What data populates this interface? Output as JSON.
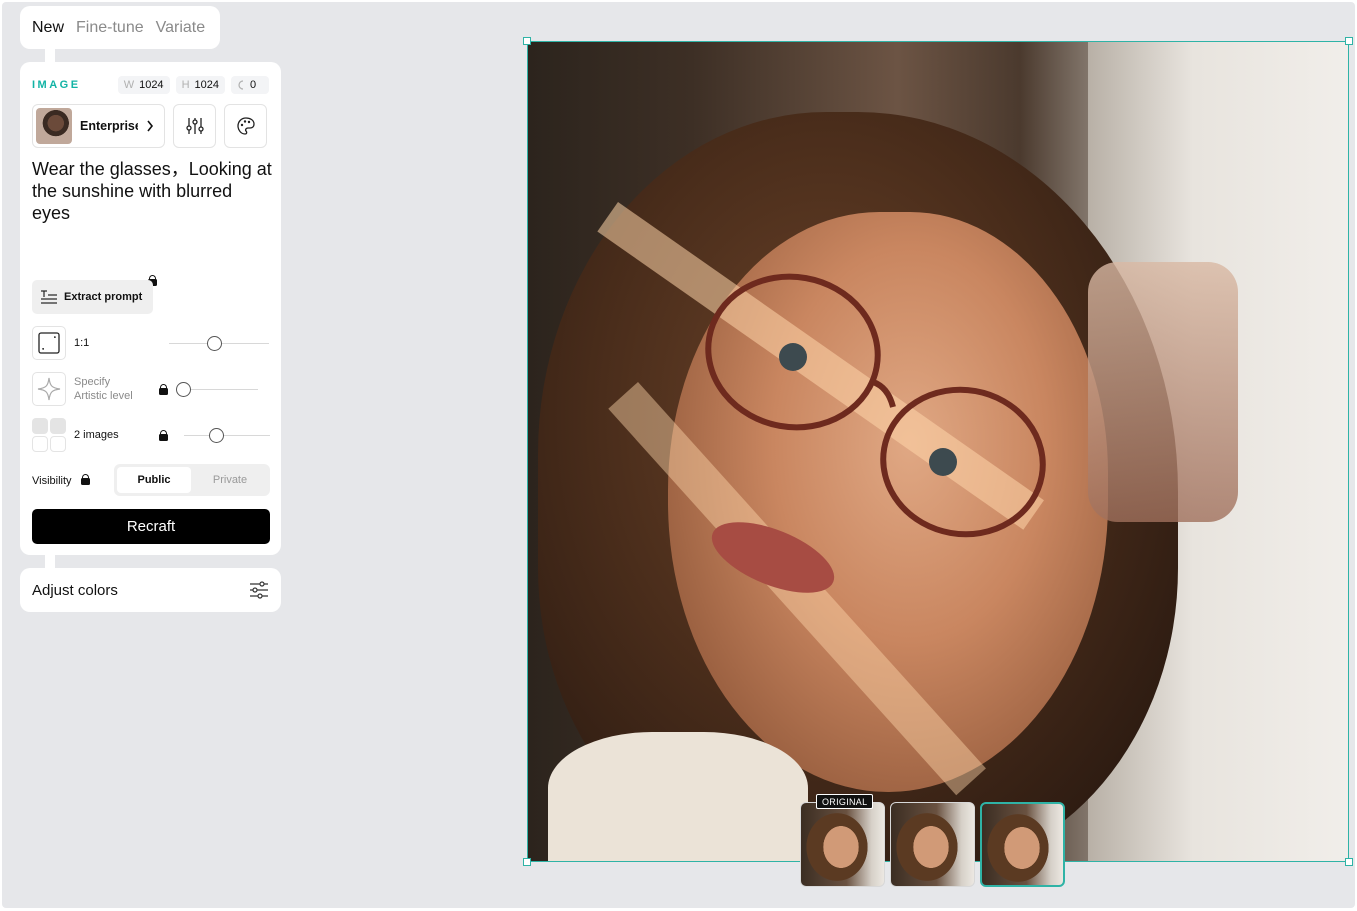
{
  "tabs": [
    {
      "label": "New",
      "active": true
    },
    {
      "label": "Fine-tune",
      "active": false
    },
    {
      "label": "Variate",
      "active": false
    }
  ],
  "panel": {
    "section_label": "IMAGE",
    "width_key": "W",
    "width_value": "1024",
    "height_key": "H",
    "height_value": "1024",
    "seed_value": "0",
    "model_label": "Enterprise",
    "prompt": "Wear the glasses，Looking at the sunshine with blurred eyes",
    "extract_label": "Extract prompt",
    "aspect_label": "1:1",
    "artistic_label_1": "Specify",
    "artistic_label_2": "Artistic level",
    "images_label": "2 images",
    "visibility_label": "Visibility",
    "visibility_options": [
      "Public",
      "Private"
    ],
    "visibility_selected": "Public",
    "recraft_label": "Recraft"
  },
  "adjust": {
    "label": "Adjust colors"
  },
  "thumbnails": {
    "original_tag": "ORIGINAL",
    "selected_index": 2
  },
  "colors": {
    "accent": "#12b3a5",
    "selection": "#2fb3a6",
    "button": "#000000"
  }
}
